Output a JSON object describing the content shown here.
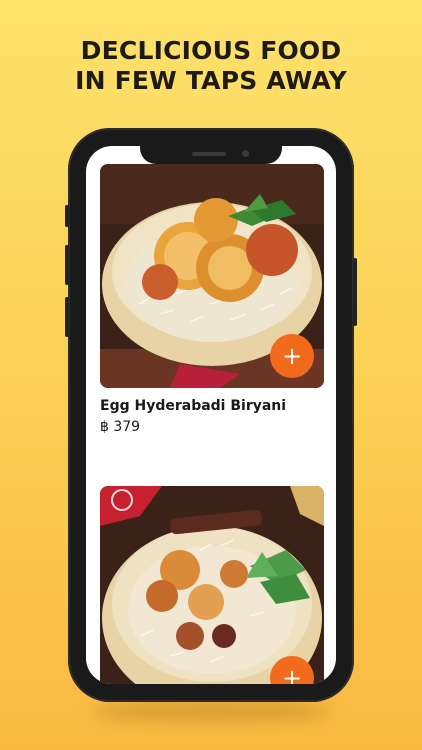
{
  "headline": {
    "line1": "DECLICIOUS FOOD",
    "line2": "IN FEW TAPS AWAY"
  },
  "menu": {
    "items": [
      {
        "name": "Egg Hyderabadi Biryani",
        "price": "฿ 379",
        "add_icon": "+",
        "image": "egg-biryani-photo"
      },
      {
        "name": "",
        "price": "",
        "add_icon": "+",
        "image": "vegetable-biryani-photo"
      }
    ]
  },
  "colors": {
    "background_top": "#fde26c",
    "background_bottom": "#f9b941",
    "accent": "#f26a1b",
    "phone_frame": "#1a1a1a"
  }
}
